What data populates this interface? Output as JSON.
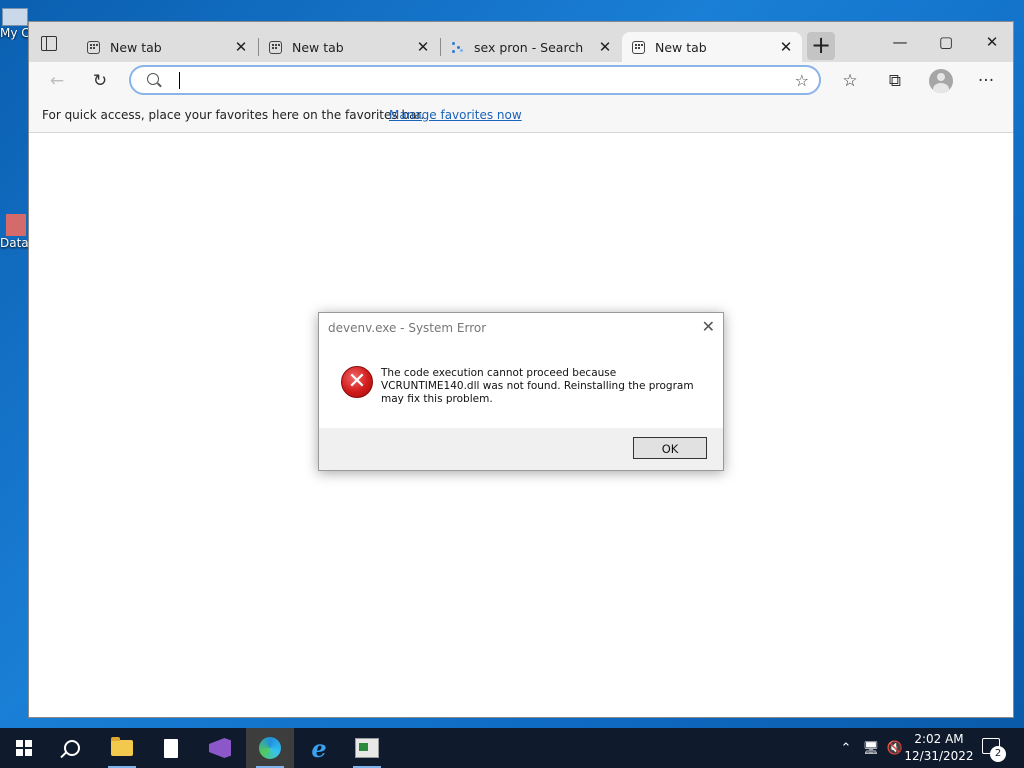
{
  "desktop": {
    "icons": [
      {
        "label": "My C"
      },
      {
        "label": "Data"
      }
    ]
  },
  "browser": {
    "tabs": [
      {
        "title": "New tab",
        "icon": "new-tab-icon",
        "close": "✕"
      },
      {
        "title": "New tab",
        "icon": "new-tab-icon",
        "close": "✕"
      },
      {
        "title": "sex pron - Search",
        "icon": "search-tab-icon",
        "close": "✕"
      },
      {
        "title": "New tab",
        "icon": "new-tab-icon",
        "close": "✕",
        "active": true
      }
    ],
    "new_tab_label": "+",
    "window_controls": {
      "minimize": "—",
      "maximize": "▢",
      "close": "✕"
    },
    "toolbar": {
      "back": "←",
      "refresh": "↻",
      "address_value": "",
      "favorites": "☆",
      "collections": "⧉",
      "more": "···"
    },
    "favorites_bar": {
      "message": "For quick access, place your favorites here on the favorites bar.",
      "link": "Manage favorites now"
    }
  },
  "dialog": {
    "title": "devenv.exe - System Error",
    "close": "✕",
    "icon": "error-icon",
    "message": "The code execution cannot proceed because VCRUNTIME140.dll was not found. Reinstalling the program may fix this problem.",
    "ok_label": "OK"
  },
  "taskbar": {
    "apps": [
      "start",
      "search",
      "file-explorer",
      "notepad",
      "visual-studio",
      "edge",
      "internet-explorer",
      "app"
    ],
    "tray": {
      "chevron": "⌃",
      "volume_muted": true
    },
    "time": "2:02 AM",
    "date": "12/31/2022",
    "notification_count": "2"
  }
}
